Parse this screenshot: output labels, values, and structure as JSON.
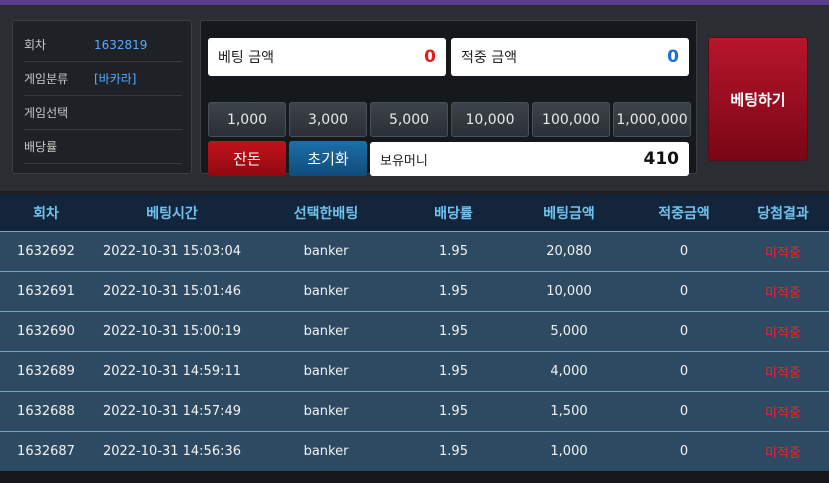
{
  "info": {
    "rows": [
      {
        "label": "회차",
        "value": "1632819"
      },
      {
        "label": "게임분류",
        "value": "[바카라]"
      },
      {
        "label": "게임선택",
        "value": ""
      },
      {
        "label": "배당률",
        "value": ""
      }
    ]
  },
  "bet": {
    "bet_amount_label": "베팅 금액",
    "bet_amount_value": "0",
    "win_amount_label": "적중 금액",
    "win_amount_value": "0",
    "chips": [
      "1,000",
      "3,000",
      "5,000",
      "10,000",
      "100,000",
      "1,000,000"
    ],
    "remainder_label": "잔돈",
    "reset_label": "초기화",
    "money_label": "보유머니",
    "money_value": "410",
    "bet_button_label": "베팅하기"
  },
  "history": {
    "columns": [
      "회차",
      "베팅시간",
      "선택한배팅",
      "배당률",
      "베팅금액",
      "적중금액",
      "당첨결과"
    ],
    "rows": [
      [
        "1632692",
        "2022-10-31 15:03:04",
        "banker",
        "1.95",
        "20,080",
        "0",
        "미적중"
      ],
      [
        "1632691",
        "2022-10-31 15:01:46",
        "banker",
        "1.95",
        "10,000",
        "0",
        "미적중"
      ],
      [
        "1632690",
        "2022-10-31 15:00:19",
        "banker",
        "1.95",
        "5,000",
        "0",
        "미적중"
      ],
      [
        "1632689",
        "2022-10-31 14:59:11",
        "banker",
        "1.95",
        "4,000",
        "0",
        "미적중"
      ],
      [
        "1632688",
        "2022-10-31 14:57:49",
        "banker",
        "1.95",
        "1,500",
        "0",
        "미적중"
      ],
      [
        "1632687",
        "2022-10-31 14:56:36",
        "banker",
        "1.95",
        "1,000",
        "0",
        "미적중"
      ]
    ]
  },
  "colors": {
    "accent_blue": "#55aaff",
    "bet_value_red": "#e02020",
    "win_value_blue": "#1a6fd8",
    "result_red": "#e32a2a"
  }
}
